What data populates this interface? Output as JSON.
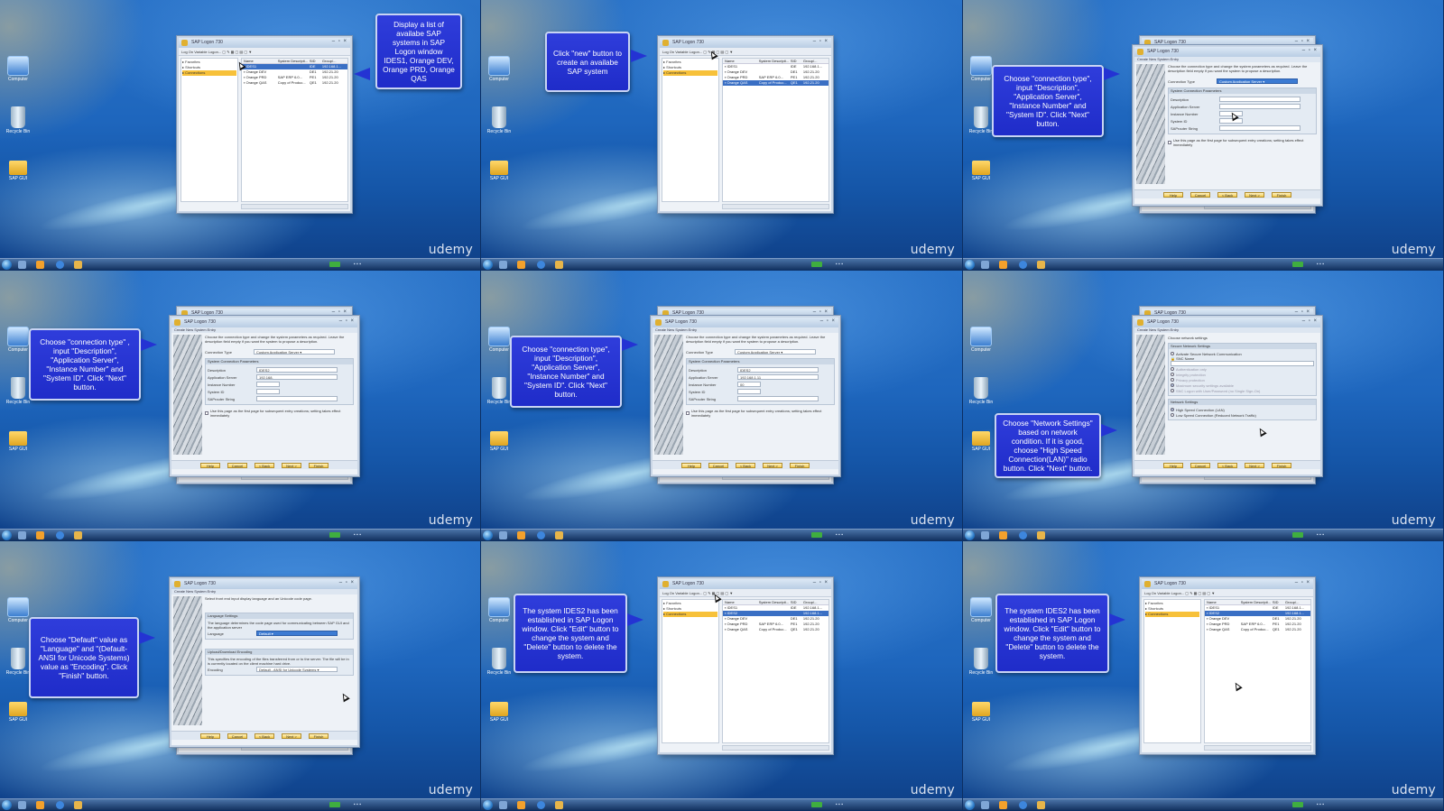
{
  "watermark": "udemy",
  "desktop": {
    "icons": [
      "computer-icon",
      "recycle-bin-icon",
      "folder-icon"
    ]
  },
  "sap_window": {
    "title": "SAP Logon 730",
    "toolbar": [
      "Log On",
      "Variable Logon..."
    ],
    "tree": [
      "Favorites",
      "Shortcuts",
      "Connections"
    ],
    "columns": [
      "Name",
      "System Descripti...",
      "SID",
      "Group/..."
    ],
    "rows_initial": [
      {
        "name": "IDES1",
        "desc": "",
        "sid": "IDE",
        "group": "192.168.1..."
      },
      {
        "name": "Orange DEV",
        "desc": "",
        "sid": "DE1",
        "group": "192.21.20"
      },
      {
        "name": "Orange PRD",
        "desc": "SAP ERP 6.0...",
        "sid": "PE1",
        "group": "192.21.20"
      },
      {
        "name": "Orange QAS",
        "desc": "Copy of Produc...",
        "sid": "QE1",
        "group": "192.21.20"
      }
    ]
  },
  "wizard": {
    "title": "SAP Logon 730",
    "subtitle": "Create New System Entry",
    "connection_type_label": "Connection Type",
    "connection_type_value": "Custom Application Server",
    "group_title": "System Connection Parameters",
    "fields": [
      "Description",
      "Application Server",
      "Instance Number",
      "System ID",
      "SAProuter String"
    ],
    "fill_a": {
      "description": "IDES2",
      "server": "192.168.",
      "instance": "",
      "sid": ""
    },
    "fill_b": {
      "description": "IDES2",
      "server": "192.168.1.11",
      "instance": "00",
      "sid": ""
    },
    "checkbox": "Use this page as the first page for subsequent entry creations; setting takes effect immediately",
    "buttons": [
      "Help",
      "Cancel",
      "< Back",
      "Next >",
      "Finish"
    ],
    "network": {
      "header": "Choose network settings",
      "secure_title": "Secure Network Settings",
      "activate": "Activate Secure Network Communication",
      "snc_name": "SNC Name",
      "options": [
        "Authentication only",
        "Integrity protection",
        "Privacy protection",
        "Maximum security settings available"
      ],
      "sso": "SNC Logon with User/Password (no Single Sign-On)",
      "net_title": "Network Settings",
      "high": "High Speed Connection (LAN)",
      "low": "Low Speed Connection (Reduced Network Traffic)"
    },
    "encoding": {
      "header": "Select front end input display language and an Unicode code page.",
      "lang_title": "Language Settings",
      "lang_desc": "The language determines the code page used for communicating between SAP GUI and the application server",
      "language_label": "Language",
      "language_value": "Default",
      "enc_title": "Upload/Download Encoding",
      "enc_desc": "This specifies the encoding of the files transferred from or to the server. The file will be in is currently located on the client machine hard drive.",
      "encoding_label": "Encoding",
      "encoding_value": "Default - ANSI for Unicode Systems"
    }
  },
  "rows_with_ides2": [
    {
      "name": "IDES1",
      "desc": "",
      "sid": "IDE",
      "group": "192.168.1..."
    },
    {
      "name": "IDES2",
      "desc": "",
      "sid": "",
      "group": "192.168.1..."
    },
    {
      "name": "Orange DEV",
      "desc": "",
      "sid": "DE1",
      "group": "192.21.20"
    },
    {
      "name": "Orange PRD",
      "desc": "SAP ERP 6.0...",
      "sid": "PE1",
      "group": "192.21.20"
    },
    {
      "name": "Orange QAS",
      "desc": "Copy of Produc...",
      "sid": "QE1",
      "group": "192.21.20"
    }
  ],
  "callouts": {
    "p1": "Display a list of availabe SAP systems in SAP Logon window IDES1, Orange DEV, Orange PRD, Orange QAS",
    "p2": "Click \"new\" button to create an availabe SAP system",
    "p3": "Choose \"connection type\", input \"Description\", \"Application Server\", \"Instance Number\" and \"System ID\". Click \"Next\" button.",
    "p4": "Choose \"connection type\" , input \"Description\", \"Application Server\", \"Instance Number\" and \"System ID\". Click \"Next\" button.",
    "p5": "Choose \"connection type\", input \"Description\", \"Application Server\", \"Instance Number\" and \"System ID\". Click \"Next\" button.",
    "p6": "Choose \"Network Settings\" based on network condition. If it is good, choose \"High Speed Connection(LAN)\" radio button. Click \"Next\" button.",
    "p7": "Choose \"Default\" value as \"Language\" and \"(Default-ANSI for Unicode Systems) value as \"Encoding\". Click \"Finish\" button.",
    "p8": "The system IDES2 has been established in SAP Logon window. Click \"Edit\" button to change the system and \"Delete\" button to delete the system.",
    "p9": "The system IDES2 has been established in SAP Logon window. Click \"Edit\" button to change the system and \"Delete\" button to delete the system."
  },
  "colors": {
    "callout": "#2433d3",
    "selection": "#3a6fc4",
    "connections_folder": "#f7c13a"
  }
}
